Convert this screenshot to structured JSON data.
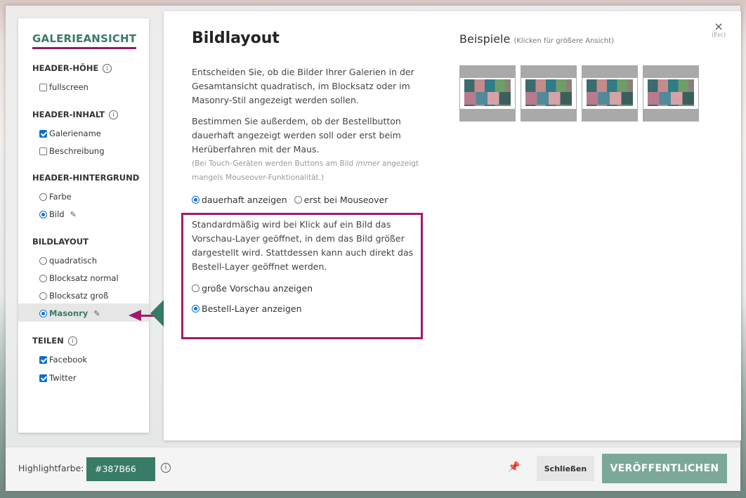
{
  "sidebar": {
    "title": "GALERIEANSICHT",
    "sections": {
      "header_hoehe": {
        "title": "HEADER-HÖHE",
        "options": [
          "fullscreen"
        ]
      },
      "header_inhalt": {
        "title": "HEADER-INHALT",
        "options": [
          "Galeriename",
          "Beschreibung"
        ]
      },
      "header_hintergrund": {
        "title": "HEADER-HINTERGRUND",
        "options": [
          "Farbe",
          "Bild"
        ]
      },
      "bildlayout": {
        "title": "BILDLAYOUT",
        "options": [
          "quadratisch",
          "Blocksatz normal",
          "Blocksatz groß",
          "Masonry"
        ]
      },
      "teilen": {
        "title": "TEILEN",
        "options": [
          "Facebook",
          "Twitter"
        ]
      }
    },
    "state": {
      "fullscreen": false,
      "galeriename": true,
      "beschreibung": false,
      "hintergrund_selected": "Bild",
      "bildlayout_selected": "Masonry",
      "facebook": true,
      "twitter": true
    }
  },
  "main": {
    "title": "Bildlayout",
    "para1": "Entscheiden Sie, ob die Bilder Ihrer Galerien in der Gesamtansicht quadratisch, im Blocksatz oder im Masonry-Stil angezeigt werden sollen.",
    "para2": "Bestimmen Sie außerdem, ob der Bestellbutton dauerhaft angezeigt werden soll oder erst beim Herüberfahren mit der Maus.",
    "note_before": "(Bei Touch-Geräten werden Buttons am Bild ",
    "note_em": "immer",
    "note_after": " angezeigt mangels Mouseover-Funktionalität.)",
    "button_options": [
      "dauerhaft anzeigen",
      "erst bei Mouseover"
    ],
    "button_selected": "dauerhaft anzeigen",
    "click_para": "Standardmäßig wird bei Klick auf ein Bild das Vorschau-Layer geöffnet, in dem das Bild größer dargestellt wird. Stattdessen kann auch direkt das Bestell-Layer geöffnet werden.",
    "click_options": [
      "große Vorschau anzeigen",
      "Bestell-Layer anzeigen"
    ],
    "click_selected": "Bestell-Layer anzeigen",
    "examples_title": "Beispiele",
    "examples_hint": "(Klicken für größere Ansicht)",
    "close_label": "×",
    "close_hint": "(Esc)"
  },
  "footer": {
    "highlight_label": "Highlightfarbe:",
    "highlight_value": "#387B66",
    "close_button": "Schließen",
    "publish_button": "VERÖFFENTLICHEN"
  },
  "colors": {
    "accent": "#387B66",
    "highlight_box": "#a31a6a",
    "publish": "#7ba898"
  },
  "icons": [
    "info-icon",
    "pencil-icon",
    "pin-icon",
    "close-icon",
    "arrow-left-icon"
  ]
}
